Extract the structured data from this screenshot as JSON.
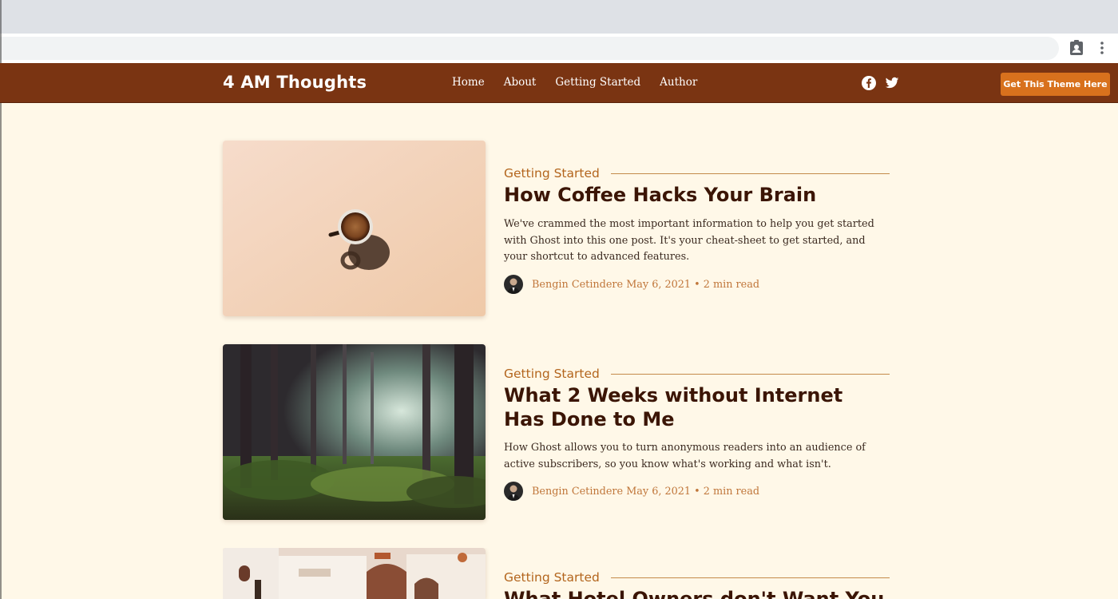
{
  "site": {
    "logo": "4 AM Thoughts",
    "nav": [
      "Home",
      "About",
      "Getting Started",
      "Author"
    ],
    "social_icons": [
      "facebook-icon",
      "twitter-icon"
    ],
    "cta_label": "Get This Theme Here"
  },
  "colors": {
    "header_bg": "#7a3412",
    "page_bg": "#fff8e8",
    "accent": "#d8711d",
    "tag": "#b3651d",
    "title": "#3b1505"
  },
  "chrome_icons": [
    "profile-icon",
    "more-vert-icon"
  ],
  "posts": [
    {
      "tag": "Getting Started",
      "title": "How Coffee Hacks Your Brain",
      "excerpt": "We've crammed the most important information to help you get started with Ghost into this one post. It's your cheat-sheet to get started, and your shortcut to advanced features.",
      "author": "Bengin Cetindere",
      "date": "May 6, 2021",
      "separator": "•",
      "read_time": "2 min read"
    },
    {
      "tag": "Getting Started",
      "title": "What 2 Weeks without Internet Has Done to Me",
      "excerpt": "How Ghost allows you to turn anonymous readers into an audience of active subscribers, so you know what's working and what isn't.",
      "author": "Bengin Cetindere",
      "date": "May 6, 2021",
      "separator": "•",
      "read_time": "2 min read"
    },
    {
      "tag": "Getting Started",
      "title": "What Hotel Owners don't Want You to"
    }
  ]
}
